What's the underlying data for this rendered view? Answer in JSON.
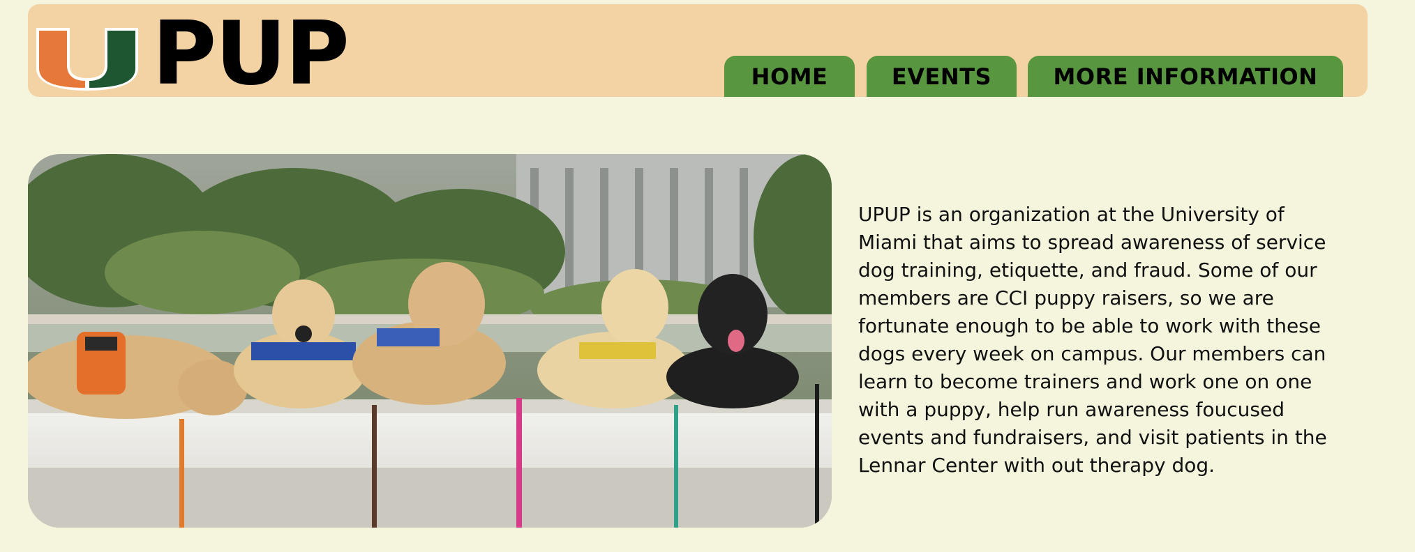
{
  "brand": {
    "name": "PUP",
    "logo_icon": "u-monogram-icon",
    "colors": {
      "orange": "#e6793a",
      "green": "#1e5631"
    }
  },
  "nav": {
    "items": [
      {
        "label": "HOME"
      },
      {
        "label": "EVENTS"
      },
      {
        "label": "MORE INFORMATION"
      }
    ],
    "color": "#58973f"
  },
  "hero": {
    "image": "service-dog-puppies-photo"
  },
  "about": {
    "text": "UPUP is an organization at the University of Miami that aims to spread awareness of service dog training, etiquette, and fraud. Some of our members are CCI puppy raisers, so we are fortunate enough to be able to work with these dogs every week on campus. Our members can learn to become trainers and work one on one with a puppy, help run awareness foucused events and fundraisers, and visit patients in the Lennar Center with out therapy dog."
  },
  "colors": {
    "page_bg": "#f5f4dd",
    "header_bg": "#f3d3a4"
  }
}
